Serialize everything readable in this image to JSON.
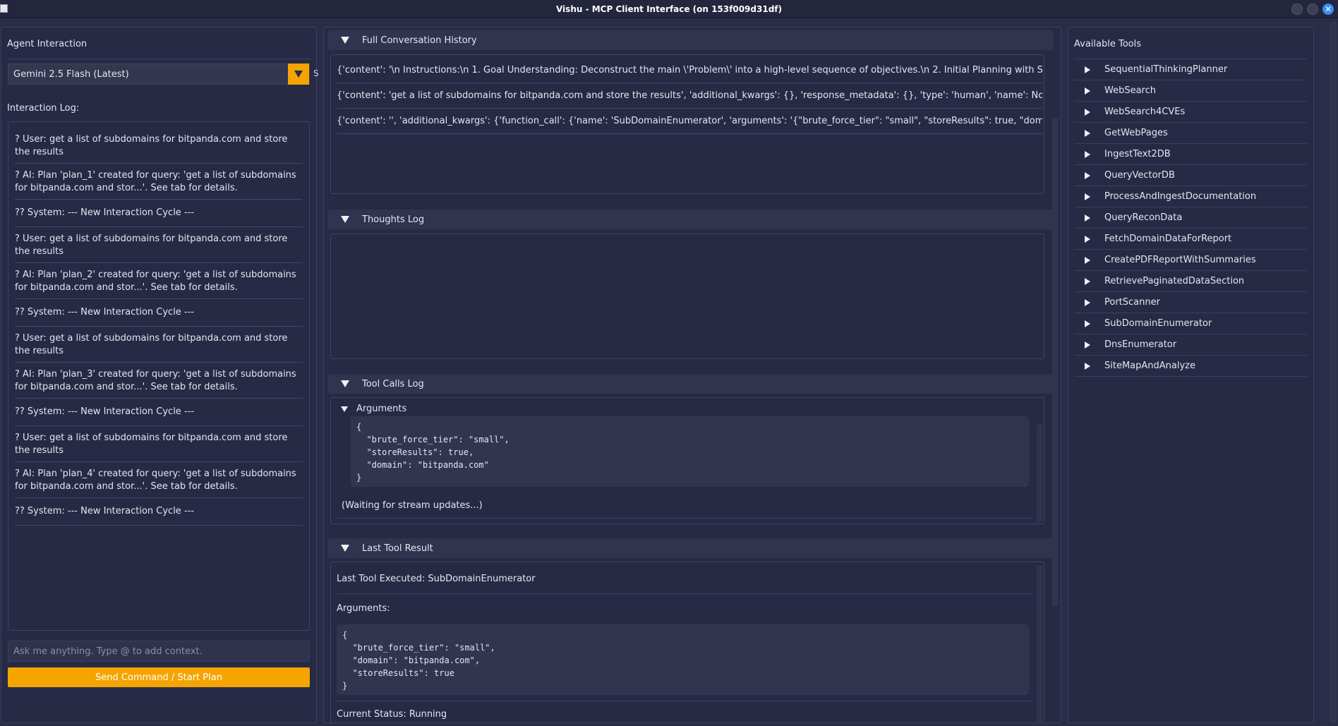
{
  "window": {
    "title": "Vishu - MCP Client Interface (on 153f009d31df)",
    "close_glyph": "✕"
  },
  "left": {
    "title": "Agent Interaction",
    "model": "Gemini 2.5 Flash (Latest)",
    "cut_label": "S",
    "log_label": "Interaction Log:",
    "log": [
      "? User: get a list of subdomains for bitpanda.com and store the results",
      "? AI: Plan 'plan_1' created for query: 'get a list of subdomains for bitpanda.com and stor...'. See tab for details.",
      "?? System: --- New Interaction Cycle ---",
      "? User: get a list of subdomains for bitpanda.com and store the results",
      "? AI: Plan 'plan_2' created for query: 'get a list of subdomains for bitpanda.com and stor...'. See tab for details.",
      "?? System: --- New Interaction Cycle ---",
      "? User: get a list of subdomains for bitpanda.com and store the results",
      "? AI: Plan 'plan_3' created for query: 'get a list of subdomains for bitpanda.com and stor...'. See tab for details.",
      "?? System: --- New Interaction Cycle ---",
      "? User: get a list of subdomains for bitpanda.com and store the results",
      "? AI: Plan 'plan_4' created for query: 'get a list of subdomains for bitpanda.com and stor...'. See tab for details.",
      "?? System: --- New Interaction Cycle ---"
    ],
    "input_placeholder": "Ask me anything. Type @ to add context.",
    "send_label": "Send Command / Start Plan"
  },
  "middle": {
    "history": {
      "label": "Full Conversation History",
      "lines": [
        "{'content': '\\n    Instructions:\\n    1. Goal Understanding: Deconstruct the main \\'Problem\\' into a high-level sequence of objectives.\\n    2. Initial Planning with STP: Use the SequentialThinkingPlanner tool to create a step-by-step plan.",
        "{'content': 'get a list of subdomains for bitpanda.com and store the results', 'additional_kwargs': {}, 'response_metadata': {}, 'type': 'human', 'name': None, 'id': None, 'example': False}",
        "{'content': '', 'additional_kwargs': {'function_call': {'name': 'SubDomainEnumerator', 'arguments': '{\"brute_force_tier\": \"small\", \"storeResults\": true, \"domain\": \"bitpanda.com\"}'}}}"
      ]
    },
    "thoughts": {
      "label": "Thoughts Log"
    },
    "tool_calls": {
      "label": "Tool Calls Log",
      "args_label": "Arguments",
      "args_code": "{\n  \"brute_force_tier\": \"small\",\n  \"storeResults\": true,\n  \"domain\": \"bitpanda.com\"\n}",
      "waiting": "(Waiting for stream updates...)"
    },
    "last_result": {
      "label": "Last Tool Result",
      "executed": "Last Tool Executed: SubDomainEnumerator",
      "args_label": "Arguments:",
      "args_code": "{\n  \"brute_force_tier\": \"small\",\n  \"domain\": \"bitpanda.com\",\n  \"storeResults\": true\n}",
      "status": "Current Status: Running"
    }
  },
  "right": {
    "title": "Available Tools",
    "tools": [
      "SequentialThinkingPlanner",
      "WebSearch",
      "WebSearch4CVEs",
      "GetWebPages",
      "IngestText2DB",
      "QueryVectorDB",
      "ProcessAndIngestDocumentation",
      "QueryReconData",
      "FetchDomainDataForReport",
      "CreatePDFReportWithSummaries",
      "RetrievePaginatedDataSection",
      "PortScanner",
      "SubDomainEnumerator",
      "DnsEnumerator",
      "SiteMapAndAnalyze"
    ]
  },
  "colors": {
    "accent": "#f5a400",
    "background": "#2a2d47",
    "panel": "#262a45"
  }
}
